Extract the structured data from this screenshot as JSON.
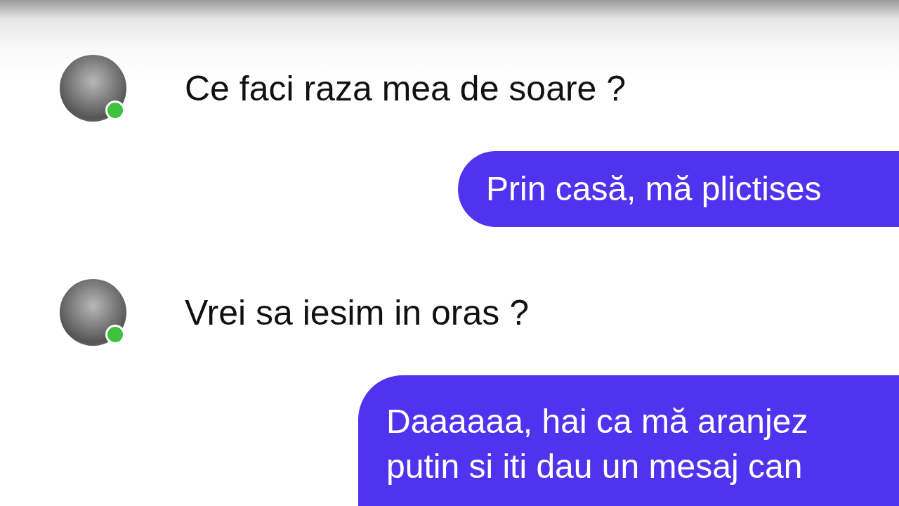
{
  "messages": [
    {
      "kind": "incoming",
      "online": true,
      "text": "Ce faci raza mea de soare ?"
    },
    {
      "kind": "outgoing",
      "lines": [
        "Prin casă, mă plictises"
      ]
    },
    {
      "kind": "incoming",
      "online": true,
      "text": "Vrei sa iesim in oras ?"
    },
    {
      "kind": "outgoing",
      "lines": [
        "Daaaaaa, hai ca mă aranjez",
        "putin si iti dau un mesaj can"
      ]
    }
  ]
}
